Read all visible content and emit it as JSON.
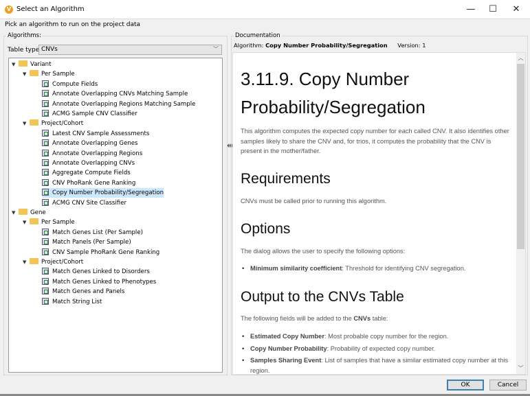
{
  "window": {
    "title": "Select an Algorithm",
    "subtitle": "Pick an algorithm to run on the project data",
    "minimize": "—",
    "maximize": "☐",
    "close": "✕",
    "logo": "V"
  },
  "left": {
    "group_label": "Algorithms:",
    "table_type_label": "Table type:",
    "table_type_value": "CNVs",
    "tree": [
      {
        "label": "Variant",
        "level": 0,
        "type": "folder"
      },
      {
        "label": "Per Sample",
        "level": 1,
        "type": "folder"
      },
      {
        "label": "Compute Fields",
        "level": 2,
        "type": "alg"
      },
      {
        "label": "Annotate Overlapping CNVs Matching Sample",
        "level": 2,
        "type": "alg"
      },
      {
        "label": "Annotate Overlapping Regions Matching Sample",
        "level": 2,
        "type": "alg"
      },
      {
        "label": "ACMG Sample CNV Classifier",
        "level": 2,
        "type": "alg"
      },
      {
        "label": "Project/Cohort",
        "level": 1,
        "type": "folder"
      },
      {
        "label": "Latest CNV Sample Assessments",
        "level": 2,
        "type": "alg"
      },
      {
        "label": "Annotate Overlapping Genes",
        "level": 2,
        "type": "alg"
      },
      {
        "label": "Annotate Overlapping Regions",
        "level": 2,
        "type": "alg"
      },
      {
        "label": "Annotate Overlapping CNVs",
        "level": 2,
        "type": "alg"
      },
      {
        "label": "Aggregate Compute Fields",
        "level": 2,
        "type": "alg"
      },
      {
        "label": "CNV PhoRank Gene Ranking",
        "level": 2,
        "type": "alg"
      },
      {
        "label": "Copy Number Probability/Segregation",
        "level": 2,
        "type": "alg",
        "selected": true
      },
      {
        "label": "ACMG CNV Site Classifier",
        "level": 2,
        "type": "alg"
      },
      {
        "label": "Gene",
        "level": 0,
        "type": "folder"
      },
      {
        "label": "Per Sample",
        "level": 1,
        "type": "folder"
      },
      {
        "label": "Match Genes List (Per Sample)",
        "level": 2,
        "type": "alg"
      },
      {
        "label": "Match Panels (Per Sample)",
        "level": 2,
        "type": "alg"
      },
      {
        "label": "CNV Sample PhoRank Gene Ranking",
        "level": 2,
        "type": "alg"
      },
      {
        "label": "Project/Cohort",
        "level": 1,
        "type": "folder"
      },
      {
        "label": "Match Genes Linked to Disorders",
        "level": 2,
        "type": "alg"
      },
      {
        "label": "Match Genes Linked to Phenotypes",
        "level": 2,
        "type": "alg"
      },
      {
        "label": "Match Genes and Panels",
        "level": 2,
        "type": "alg"
      },
      {
        "label": "Match String List",
        "level": 2,
        "type": "alg"
      }
    ]
  },
  "doc": {
    "group_label": "Documentation",
    "algorithm_label": "Algorithm:",
    "algorithm_name": "Copy Number Probability/Segregation",
    "version_label": "Version:",
    "version": "1",
    "title_line1": "3.11.9. Copy Number",
    "title_line2": "Probability/Segregation",
    "intro": "This algorithm computes the expected copy number for each called CNV. It also identifies other samples likely to share the CNV and, for trios, it computes the probability that the CNV is present in the mother/father.",
    "req_heading": "Requirements",
    "req_text": "CNVs must be called prior to running this algorithm.",
    "opt_heading": "Options",
    "opt_text": "The dialog allows the user to specify the following options:",
    "opt_item_term": "Minimum similarity coefficient",
    "opt_item_desc": ": Threshold for identifying CNV segregation.",
    "out_heading": "Output to the CNVs Table",
    "out_text_pre": "The following fields will be added to the ",
    "out_text_bold": "CNVs",
    "out_text_post": " table:",
    "out_items": [
      {
        "term": "Estimated Copy Number",
        "desc": ": Most probable copy number for the region."
      },
      {
        "term": "Copy Number Probability",
        "desc": ": Probability of expected copy number."
      },
      {
        "term": "Samples Sharing Event",
        "desc": ": List of samples that have a similar estimated copy number at this region."
      }
    ]
  },
  "buttons": {
    "ok": "OK",
    "cancel": "Cancel"
  }
}
